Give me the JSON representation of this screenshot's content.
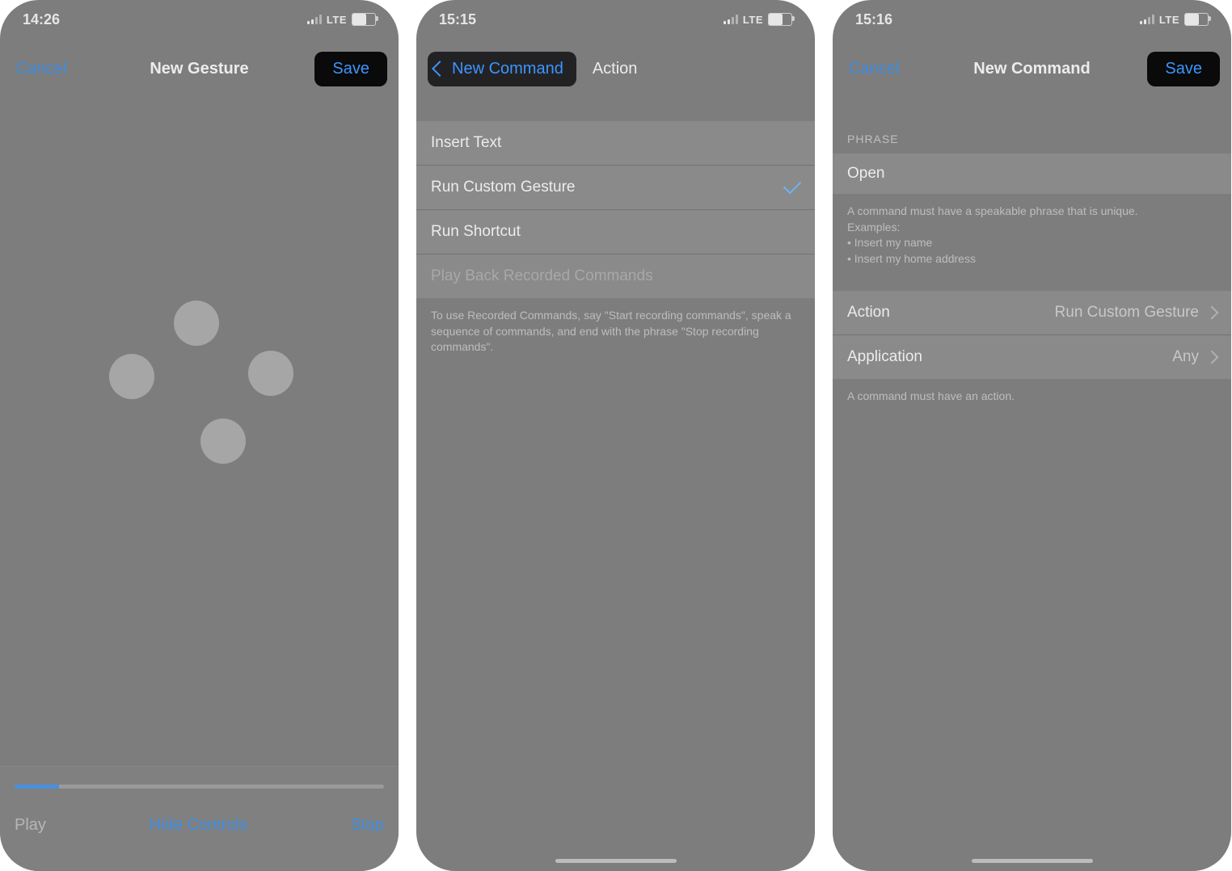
{
  "screen1": {
    "time": "14:26",
    "lte": "LTE",
    "cancel": "Cancel",
    "title": "New Gesture",
    "save": "Save",
    "footer": {
      "play": "Play",
      "hide": "Hide Controls",
      "stop": "Stop"
    }
  },
  "screen2": {
    "time": "15:15",
    "lte": "LTE",
    "back": "New Command",
    "title": "Action",
    "options": {
      "insert_text": "Insert Text",
      "run_custom_gesture": "Run Custom Gesture",
      "run_shortcut": "Run Shortcut",
      "play_back": "Play Back Recorded Commands"
    },
    "footnote": "To use Recorded Commands, say \"Start recording commands\", speak a sequence of commands, and end with the phrase \"Stop recording commands\"."
  },
  "screen3": {
    "time": "15:16",
    "lte": "LTE",
    "cancel": "Cancel",
    "title": "New Command",
    "save": "Save",
    "phrase_header": "PHRASE",
    "phrase_value": "Open",
    "phrase_help": "A command must have a speakable phrase that is unique.\nExamples:\n• Insert my name\n• Insert my home address",
    "rows": {
      "action_label": "Action",
      "action_value": "Run Custom Gesture",
      "application_label": "Application",
      "application_value": "Any"
    },
    "action_help": "A command must have an action."
  }
}
